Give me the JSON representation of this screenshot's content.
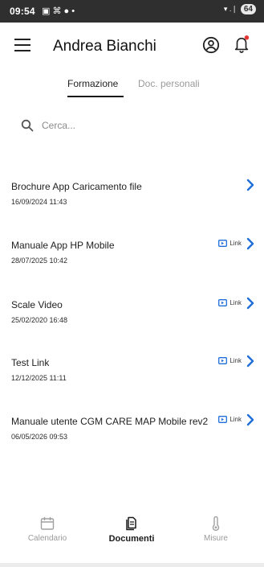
{
  "status_bar": {
    "time": "09:54",
    "notification_icons": "▣ ⌘ ● •",
    "signal_text": "▾ .❘",
    "battery": "64"
  },
  "header": {
    "title": "Andrea Bianchi",
    "menu_icon": "hamburger-menu",
    "account_icon": "account-circle",
    "bell_icon": "notification-bell",
    "bell_badge_color": "#e53935"
  },
  "tabs": [
    {
      "label": "Formazione",
      "active": true
    },
    {
      "label": "Doc. personali",
      "active": false
    }
  ],
  "search": {
    "placeholder": "Cerca...",
    "value": ""
  },
  "accent_color": "#1e6fd9",
  "documents": [
    {
      "title": "Brochure App Caricamento file",
      "date": "16/09/2024 11:43",
      "link_label": ""
    },
    {
      "title": "Manuale App HP Mobile",
      "date": "28/07/2025 10:42",
      "link_label": "Link"
    },
    {
      "title": "Scale Video",
      "date": "25/02/2020 16:48",
      "link_label": "Link"
    },
    {
      "title": "Test Link",
      "date": "12/12/2025 11:11",
      "link_label": "Link"
    },
    {
      "title": "Manuale utente CGM CARE MAP Mobile rev2",
      "date": "06/05/2026 09:53",
      "link_label": "Link"
    }
  ],
  "bottom_nav": [
    {
      "label": "Calendario",
      "icon": "calendar-icon",
      "active": false
    },
    {
      "label": "Documenti",
      "icon": "documents-icon",
      "active": true
    },
    {
      "label": "Misure",
      "icon": "thermometer-icon",
      "active": false
    }
  ]
}
